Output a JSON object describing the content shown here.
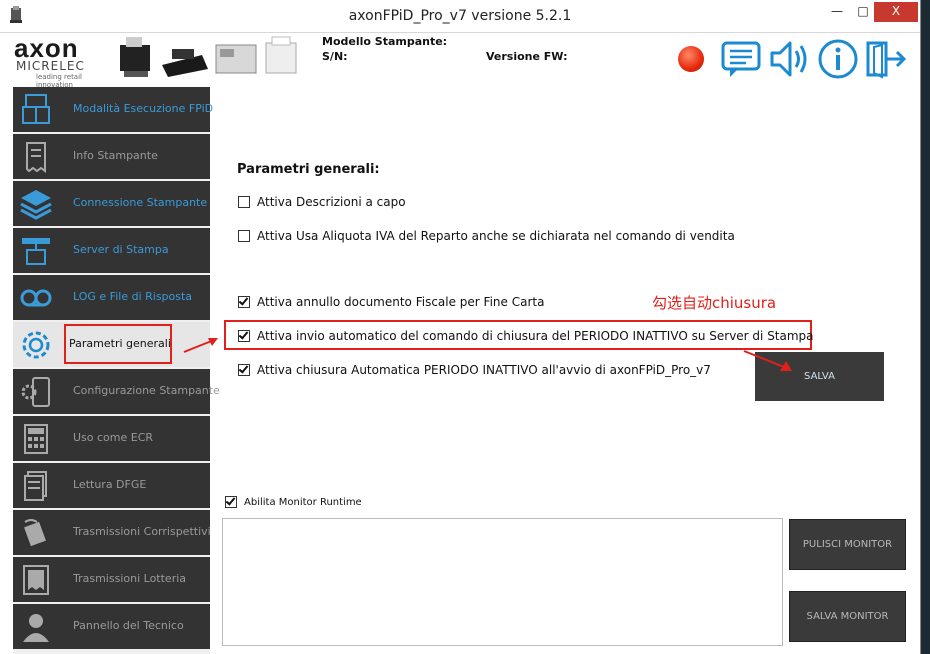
{
  "window": {
    "title": "axonFPiD_Pro_v7 versione 5.2.1",
    "min_label": "—",
    "max_label": "□",
    "close_label": "X"
  },
  "header": {
    "logo_main": "axon",
    "logo_sub": "MICRELEC",
    "logo_tagline": "leading retail innovation",
    "model_label": "Modello Stampante:",
    "sn_label": "S/N:",
    "fw_label": "Versione FW:",
    "status_color": "#e8280c",
    "icons": [
      "chat-icon",
      "speaker-icon",
      "info-icon",
      "exit-icon"
    ]
  },
  "sidebar": {
    "items": [
      {
        "label": "Modalità Esecuzione FPiD",
        "icon": "pos-terminal-icon",
        "style": "blue"
      },
      {
        "label": "Info Stampante",
        "icon": "receipt-icon",
        "style": "grey"
      },
      {
        "label": "Connessione Stampante",
        "icon": "layers-icon",
        "style": "blue"
      },
      {
        "label": "Server di Stampa",
        "icon": "print-server-icon",
        "style": "blue"
      },
      {
        "label": "LOG e File di Risposta",
        "icon": "tape-icon",
        "style": "blue"
      },
      {
        "label": "Parametri generali",
        "icon": "gear-icon",
        "style": "active"
      },
      {
        "label": "Configurazione Stampante",
        "icon": "device-gear-icon",
        "style": "grey"
      },
      {
        "label": "Uso come ECR",
        "icon": "calculator-icon",
        "style": "grey"
      },
      {
        "label": "Lettura DFGE",
        "icon": "documents-icon",
        "style": "grey"
      },
      {
        "label": "Trasmissioni Corrispettivi",
        "icon": "transmission-icon",
        "style": "grey"
      },
      {
        "label": "Trasmissioni Lotteria",
        "icon": "lottery-receipt-icon",
        "style": "grey"
      },
      {
        "label": "Pannello del Tecnico",
        "icon": "technician-icon",
        "style": "grey"
      }
    ]
  },
  "main": {
    "section_title": "Parametri generali:",
    "options": [
      {
        "label": "Attiva Descrizioni a capo",
        "checked": false
      },
      {
        "label": "Attiva Usa Aliquota IVA del Reparto anche se dichiarata nel comando di vendita",
        "checked": false
      },
      {
        "label": "Attiva annullo documento Fiscale per Fine Carta",
        "checked": true
      },
      {
        "label": "Attiva invio automatico del comando di chiusura del PERIODO INATTIVO su Server di Stampa",
        "checked": true
      },
      {
        "label": "Attiva chiusura Automatica PERIODO INATTIVO all'avvio di axonFPiD_Pro_v7",
        "checked": true
      }
    ],
    "annotation": "勾选自动chiusura",
    "save_label": "SALVA",
    "monitor_toggle": {
      "label": "Abilita Monitor Runtime",
      "checked": true
    },
    "clear_monitor_label": "PULISCI MONITOR",
    "save_monitor_label": "SALVA MONITOR"
  }
}
